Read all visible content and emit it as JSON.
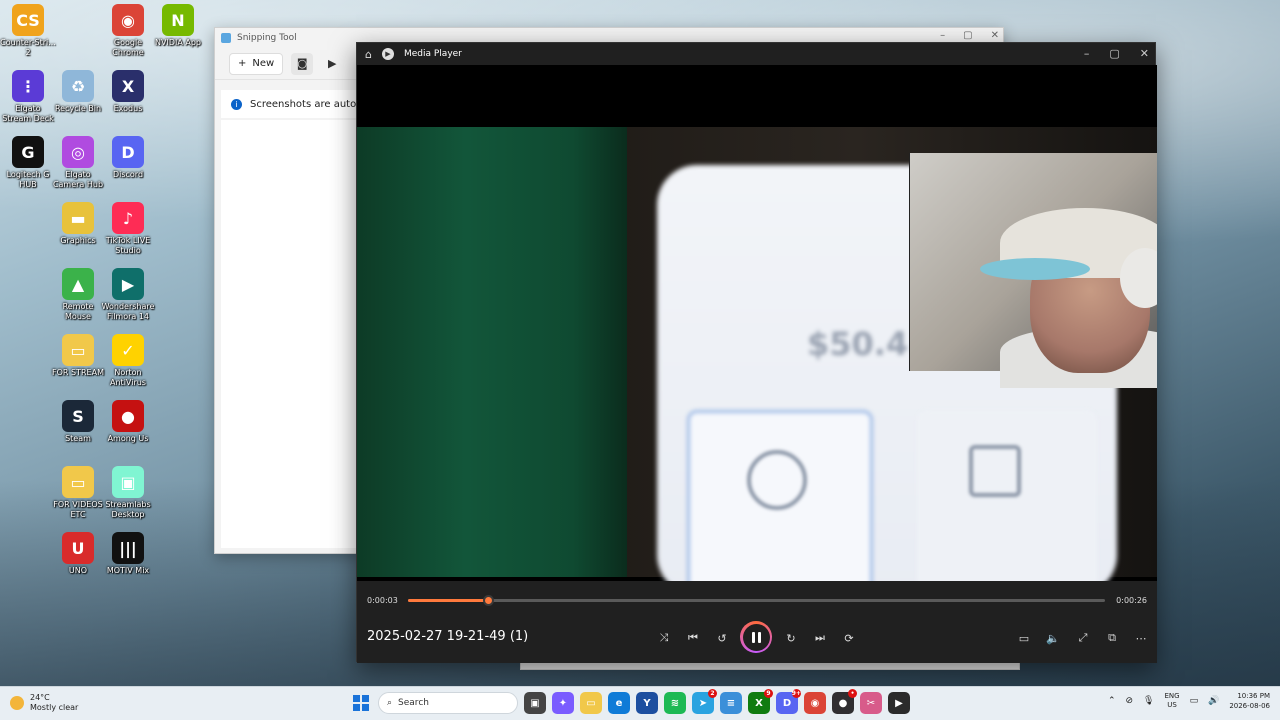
{
  "desktop": {
    "icons": [
      {
        "label": "Counter-Stri... 2",
        "color": "#f0a31c",
        "glyph": "CS"
      },
      {
        "label": "Google Chrome",
        "color": "#db4437",
        "glyph": "◉"
      },
      {
        "label": "NVIDIA App",
        "color": "#76b900",
        "glyph": "N"
      },
      {
        "label": "Elgato Stream Deck",
        "color": "#5b3bd6",
        "glyph": "⋮"
      },
      {
        "label": "Recycle Bin",
        "color": "#8fb7d9",
        "glyph": "♻"
      },
      {
        "label": "Exodus",
        "color": "#2a2f6b",
        "glyph": "X"
      },
      {
        "label": "Logitech G HUB",
        "color": "#111111",
        "glyph": "G"
      },
      {
        "label": "Elgato Camera Hub",
        "color": "#b04be0",
        "glyph": "◎"
      },
      {
        "label": "Discord",
        "color": "#5865f2",
        "glyph": "D"
      },
      {
        "label": "Graphics",
        "color": "#e8c23b",
        "glyph": "▬"
      },
      {
        "label": "TikTok LIVE Studio",
        "color": "#fe2c55",
        "glyph": "♪"
      },
      {
        "label": "Remote Mouse",
        "color": "#3bb24a",
        "glyph": "▲"
      },
      {
        "label": "Wondershare Filmora 14",
        "color": "#0f6f6a",
        "glyph": "▶"
      },
      {
        "label": "FOR STREAM",
        "color": "#f1c84a",
        "glyph": "▭"
      },
      {
        "label": "Norton AntiVirus",
        "color": "#ffd200",
        "glyph": "✓"
      },
      {
        "label": "Steam",
        "color": "#1b2838",
        "glyph": "S"
      },
      {
        "label": "Among Us",
        "color": "#c51111",
        "glyph": "●"
      },
      {
        "label": "FOR VIDEOS ETC",
        "color": "#f1c84a",
        "glyph": "▭"
      },
      {
        "label": "Streamlabs Desktop",
        "color": "#80f5d2",
        "glyph": "▣"
      },
      {
        "label": "UNO",
        "color": "#d92b2b",
        "glyph": "U"
      },
      {
        "label": "MOTIV Mix",
        "color": "#111111",
        "glyph": "|||"
      }
    ]
  },
  "snipping_tool": {
    "title": "Snipping Tool",
    "new_label": "New",
    "info_text": "Screenshots are automati"
  },
  "media_player": {
    "title": "Media Player",
    "time_current": "0:00:03",
    "time_total": "0:00:26",
    "progress_fraction": 0.115,
    "file_name": "2025-02-27 19-21-49 (1)",
    "video_amount_text": "$50.4",
    "icons": {
      "shuffle": "⤨",
      "previous": "⏮",
      "rewind": "↺",
      "forward": "↻",
      "next": "⏭",
      "repeat": "⟳",
      "subtitles": "▭",
      "volume": "🔈",
      "fullscreen": "⤢",
      "miniplayer": "⧉",
      "more": "⋯"
    }
  },
  "taskbar": {
    "weather_temp": "24°C",
    "weather_desc": "Mostly clear",
    "search_label": "Search",
    "lang_line1": "ENG",
    "lang_line2": "US",
    "time": "10:36 PM",
    "date": "2026-08-06",
    "apps": [
      {
        "name": "task-view",
        "color": "#444444",
        "glyph": "▣",
        "badge": ""
      },
      {
        "name": "copilot",
        "color": "#7a5cff",
        "glyph": "✦",
        "badge": ""
      },
      {
        "name": "file-explorer",
        "color": "#f1c84a",
        "glyph": "▭",
        "badge": ""
      },
      {
        "name": "edge",
        "color": "#0f7bd7",
        "glyph": "e",
        "badge": ""
      },
      {
        "name": "app-y",
        "color": "#1d4fa0",
        "glyph": "Y",
        "badge": ""
      },
      {
        "name": "spotify",
        "color": "#1db954",
        "glyph": "≋",
        "badge": ""
      },
      {
        "name": "telegram",
        "color": "#2aa3e0",
        "glyph": "➤",
        "badge": "2"
      },
      {
        "name": "notepad",
        "color": "#3b8fd9",
        "glyph": "≡",
        "badge": ""
      },
      {
        "name": "xbox",
        "color": "#107c10",
        "glyph": "X",
        "badge": "9"
      },
      {
        "name": "discord",
        "color": "#5865f2",
        "glyph": "D",
        "badge": "9+"
      },
      {
        "name": "chrome",
        "color": "#db4437",
        "glyph": "◉",
        "badge": ""
      },
      {
        "name": "obs",
        "color": "#302e31",
        "glyph": "●",
        "badge": "•"
      },
      {
        "name": "snipping-tool",
        "color": "#d85b8a",
        "glyph": "✂",
        "badge": ""
      },
      {
        "name": "media-player",
        "color": "#2b2b2b",
        "glyph": "▶",
        "badge": ""
      }
    ]
  }
}
